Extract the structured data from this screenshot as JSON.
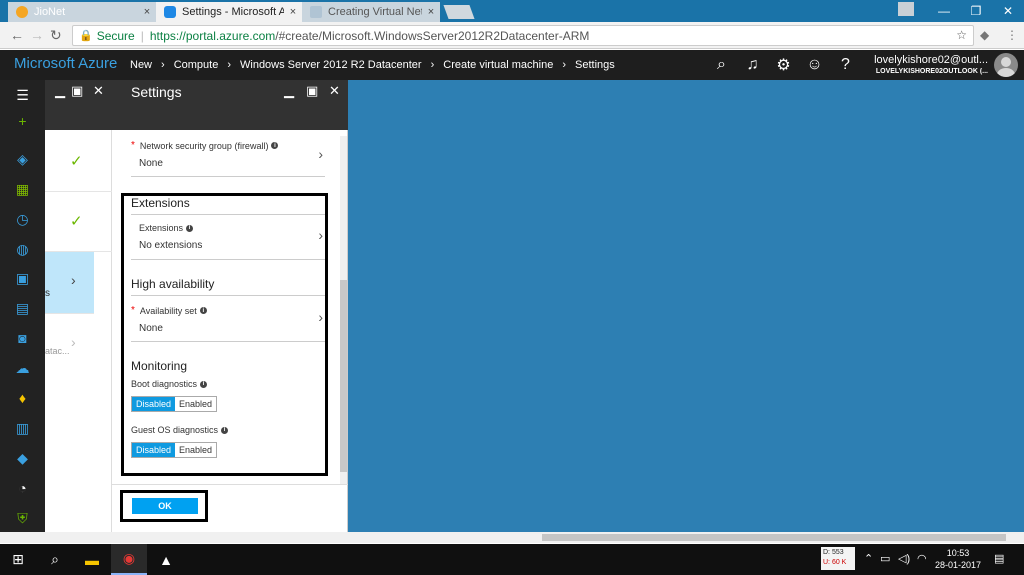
{
  "browser": {
    "tabs": [
      {
        "title": "JioNet",
        "favicon_color": "#f5a623"
      },
      {
        "title": "Settings - Microsoft Azur",
        "favicon_color": "#1e88e5"
      },
      {
        "title": "Creating Virtual Network",
        "favicon_color": "#b0c4d4"
      }
    ],
    "close_glyph": "×",
    "secure_label": "Secure",
    "url_host": "https://portal.azure.com",
    "url_path": "/#create/Microsoft.WindowsServer2012R2Datacenter-ARM"
  },
  "azure": {
    "brand": "Microsoft Azure",
    "breadcrumbs": [
      "New",
      "Compute",
      "Windows Server 2012 R2 Datacenter",
      "Create virtual machine",
      "Settings"
    ],
    "account_name": "lovelykishore02@outl...",
    "account_tenant": "LOVELYKISHORE02OUTLOOK (..."
  },
  "sidebar": {
    "items": [
      {
        "icon": "hamburger-icon",
        "glyph": "☰",
        "color": "#ffffff"
      },
      {
        "icon": "plus-icon",
        "glyph": "+",
        "color": "#6bb700"
      },
      {
        "icon": "cube-icon",
        "glyph": "◈",
        "color": "#3aa0e0"
      },
      {
        "icon": "grid-icon",
        "glyph": "▦",
        "color": "#7fba00"
      },
      {
        "icon": "clock-icon",
        "glyph": "◷",
        "color": "#3aa0e0"
      },
      {
        "icon": "globe-icon",
        "glyph": "◍",
        "color": "#3aa0e0"
      },
      {
        "icon": "monitor-icon",
        "glyph": "▣",
        "color": "#3aa0e0"
      },
      {
        "icon": "vm-icon",
        "glyph": "▤",
        "color": "#3aa0e0"
      },
      {
        "icon": "sql-icon",
        "glyph": "◙",
        "color": "#3aa0e0"
      },
      {
        "icon": "cloud-icon",
        "glyph": "☁",
        "color": "#3aa0e0"
      },
      {
        "icon": "key-icon",
        "glyph": "♦",
        "color": "#f5c400"
      },
      {
        "icon": "storage-icon",
        "glyph": "▥",
        "color": "#3aa0e0"
      },
      {
        "icon": "diamond-icon",
        "glyph": "◆",
        "color": "#3aa0e0"
      },
      {
        "icon": "gauge-icon",
        "glyph": "◔",
        "color": "#f5f5f5"
      },
      {
        "icon": "shield-icon",
        "glyph": "⛨",
        "color": "#6bb700"
      }
    ]
  },
  "blade1": {
    "highlighted_row_label": "s",
    "row4_label": "atac..."
  },
  "settings": {
    "title": "Settings",
    "nsg": {
      "label": "Network security group (firewall)",
      "value": "None"
    },
    "extensions_section": "Extensions",
    "extensions": {
      "label": "Extensions",
      "value": "No extensions"
    },
    "ha_section": "High availability",
    "availability_set": {
      "label": "Availability set",
      "value": "None"
    },
    "monitoring_section": "Monitoring",
    "boot_diag": {
      "label": "Boot diagnostics",
      "options": [
        "Disabled",
        "Enabled"
      ],
      "selected": "Disabled"
    },
    "guest_diag": {
      "label": "Guest OS diagnostics",
      "options": [
        "Disabled",
        "Enabled"
      ],
      "selected": "Disabled"
    },
    "ok_label": "OK"
  },
  "taskbar": {
    "net_down": "D: 553",
    "net_up": "U: 60 K",
    "time": "10:53",
    "date": "28-01-2017"
  },
  "colors": {
    "portal_blue": "#2d7fb3",
    "accent": "#00a1f1",
    "dark": "#1e1e1e"
  }
}
